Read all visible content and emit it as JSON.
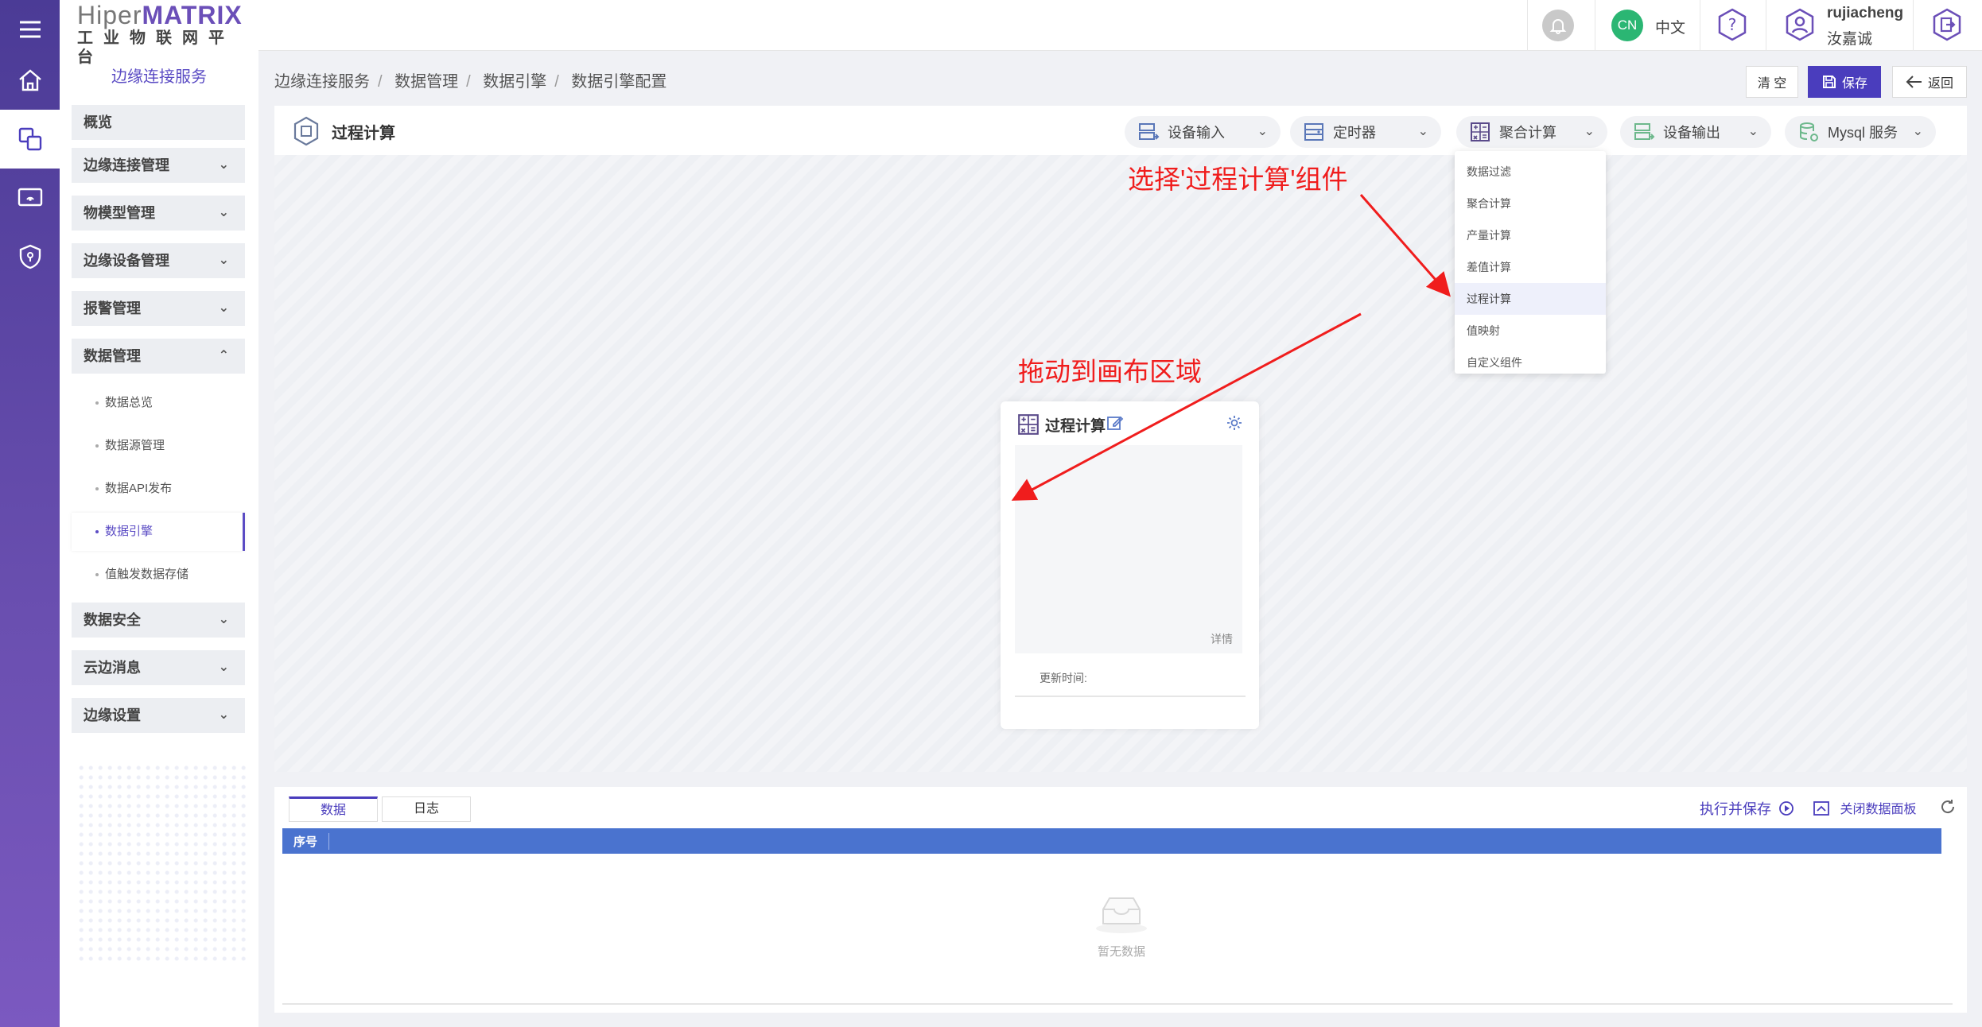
{
  "brand": {
    "name_part1": "Hiper",
    "name_part2": "MATRIX",
    "subtitle": "工业物联网平台"
  },
  "sidebar": {
    "service_title": "边缘连接服务",
    "menu": [
      {
        "label": "概览"
      },
      {
        "label": "边缘连接管理"
      },
      {
        "label": "物模型管理"
      },
      {
        "label": "边缘设备管理"
      },
      {
        "label": "报警管理"
      },
      {
        "label": "数据管理"
      },
      {
        "label": "数据安全"
      },
      {
        "label": "云边消息"
      },
      {
        "label": "边缘设置"
      }
    ],
    "data_submenu": [
      {
        "label": "数据总览"
      },
      {
        "label": "数据源管理"
      },
      {
        "label": "数据API发布"
      },
      {
        "label": "数据引擎"
      },
      {
        "label": "值触发数据存储"
      }
    ]
  },
  "header": {
    "lang_badge": "CN",
    "lang_label": "中文",
    "user_name": "rujiacheng",
    "user_display": "汝嘉诚"
  },
  "breadcrumb": [
    "边缘连接服务",
    "数据管理",
    "数据引擎",
    "数据引擎配置"
  ],
  "toolbar": {
    "clear_label": "清 空",
    "save_label": "保存",
    "back_label": "返回"
  },
  "editor": {
    "title": "过程计算",
    "palette": [
      {
        "label": "设备输入"
      },
      {
        "label": "定时器"
      },
      {
        "label": "聚合计算"
      },
      {
        "label": "设备输出"
      },
      {
        "label": "Mysql 服务"
      }
    ],
    "dropdown": [
      "数据过滤",
      "聚合计算",
      "产量计算",
      "差值计算",
      "过程计算",
      "值映射",
      "自定义组件"
    ],
    "node": {
      "title": "过程计算",
      "detail_label": "详情",
      "update_label": "更新时间:"
    },
    "annotations": {
      "select": "选择'过程计算'组件",
      "drag": "拖动到画布区域"
    }
  },
  "data_panel": {
    "tabs": [
      "数据",
      "日志"
    ],
    "run_save_label": "执行并保存",
    "close_label": "关闭数据面板",
    "columns": [
      "序号"
    ],
    "empty_text": "暂无数据"
  },
  "colors": {
    "accent": "#4a3dbd",
    "rail": "#5a45a8",
    "table_header": "#4a73cf",
    "annotation": "#f01d1d"
  }
}
